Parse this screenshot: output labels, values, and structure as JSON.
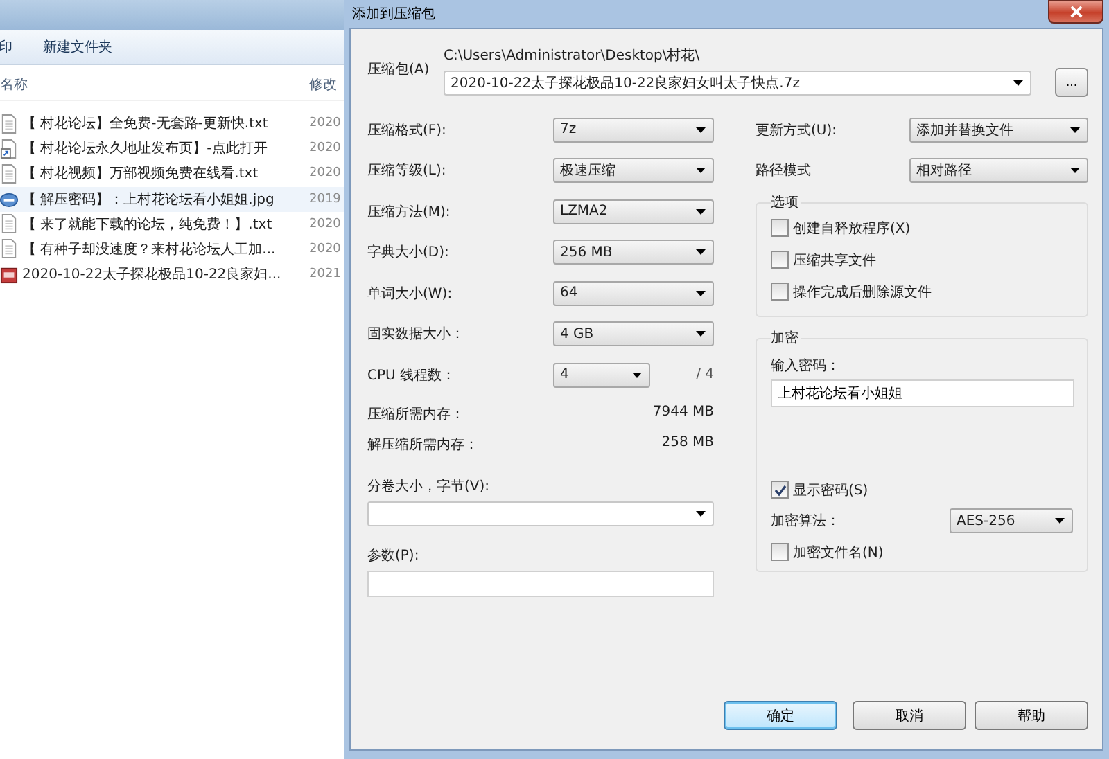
{
  "explorer": {
    "toolbar": [
      "印",
      "新建文件夹"
    ],
    "columns": [
      "名称",
      "修改"
    ],
    "files": [
      {
        "name": "【 村花论坛】全免费-无套路-更新快.txt",
        "date": "2020",
        "kind": "txt",
        "selected": false
      },
      {
        "name": "【 村花论坛永久地址发布页】-点此打开",
        "date": "2020",
        "kind": "link",
        "selected": false
      },
      {
        "name": "【 村花视频】万部视频免费在线看.txt",
        "date": "2020",
        "kind": "txt",
        "selected": false
      },
      {
        "name": "【 解压密码】：上村花论坛看小姐姐.jpg",
        "date": "2019",
        "kind": "image",
        "selected": true
      },
      {
        "name": "【 来了就能下载的论坛，纯免费！】.txt",
        "date": "2020",
        "kind": "txt",
        "selected": false
      },
      {
        "name": "【 有种子却没速度？来村花论坛人工加...",
        "date": "2020",
        "kind": "txt",
        "selected": false
      },
      {
        "name": "2020-10-22太子探花极品10-22良家妇...",
        "date": "2021",
        "kind": "archive",
        "selected": false
      }
    ]
  },
  "dialog": {
    "title": "添加到压缩包",
    "archive": {
      "label": "压缩包(A)",
      "path": "C:\\Users\\Administrator\\Desktop\\村花\\",
      "name": "2020-10-22太子探花极品10-22良家妇女叫太子快点.7z",
      "browse": "..."
    },
    "left_fields": [
      {
        "label": "压缩格式(F):",
        "value": "7z"
      },
      {
        "label": "压缩等级(L):",
        "value": "极速压缩"
      },
      {
        "label": "压缩方法(M):",
        "value": "LZMA2"
      },
      {
        "label": "字典大小(D):",
        "value": "256 MB"
      },
      {
        "label": "单词大小(W):",
        "value": "64"
      },
      {
        "label": "固实数据大小：",
        "value": "4 GB"
      }
    ],
    "cpu": {
      "label": "CPU 线程数：",
      "value": "4",
      "total": "/ 4"
    },
    "memory": [
      {
        "label": "压缩所需内存：",
        "value": "7944 MB"
      },
      {
        "label": "解压缩所需内存：",
        "value": "258 MB"
      }
    ],
    "volume": {
      "label": "分卷大小，字节(V):"
    },
    "params": {
      "label": "参数(P):"
    },
    "right_fields": [
      {
        "label": "更新方式(U):",
        "value": "添加并替换文件"
      },
      {
        "label": "路径模式",
        "value": "相对路径"
      }
    ],
    "options": {
      "title": "选项",
      "items": [
        {
          "label": "创建自释放程序(X)",
          "checked": false
        },
        {
          "label": "压缩共享文件",
          "checked": false
        },
        {
          "label": "操作完成后删除源文件",
          "checked": false
        }
      ]
    },
    "encryption": {
      "title": "加密",
      "password_label": "输入密码：",
      "password": "上村花论坛看小姐姐",
      "show_password": {
        "label": "显示密码(S)",
        "checked": true
      },
      "method_label": "加密算法：",
      "method": "AES-256",
      "encrypt_names": {
        "label": "加密文件名(N)",
        "checked": false
      }
    },
    "buttons": [
      {
        "label": "确定",
        "default": true
      },
      {
        "label": "取消",
        "default": false
      },
      {
        "label": "帮助",
        "default": false
      }
    ]
  }
}
